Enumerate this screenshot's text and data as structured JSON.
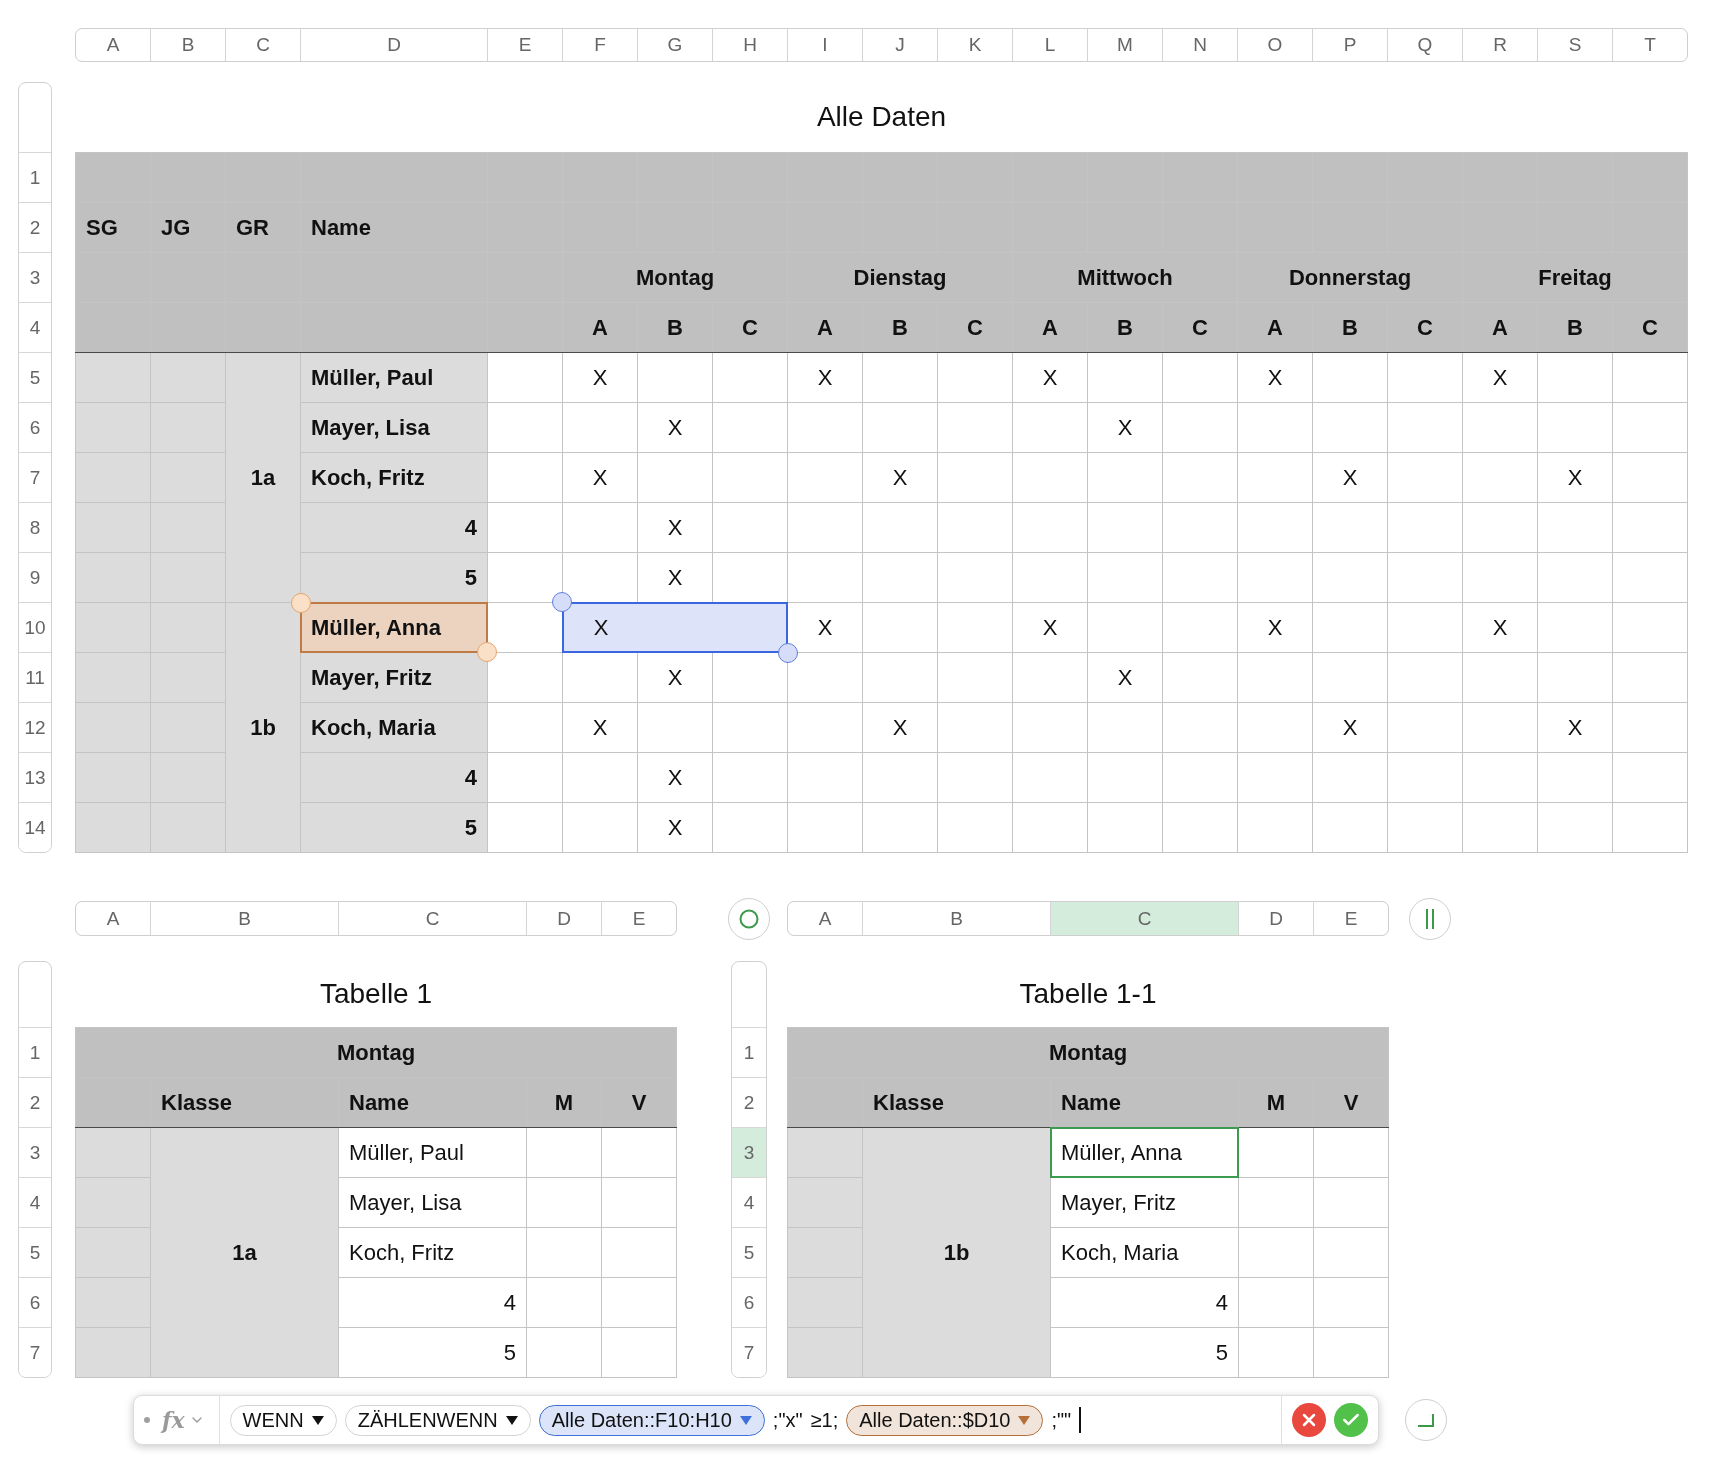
{
  "main_table": {
    "column_letters": [
      "A",
      "B",
      "C",
      "D",
      "E",
      "F",
      "G",
      "H",
      "I",
      "J",
      "K",
      "L",
      "M",
      "N",
      "O",
      "P",
      "Q",
      "R",
      "S",
      "T"
    ],
    "title": "Alle Daten",
    "row_numbers": [
      "1",
      "2",
      "3",
      "4",
      "5",
      "6",
      "7",
      "8",
      "9",
      "10",
      "11",
      "12",
      "13",
      "14"
    ],
    "header_labels": [
      "SG",
      "JG",
      "GR",
      "Name"
    ],
    "days": [
      {
        "name": "Montag",
        "slots": [
          "A",
          "B",
          "C"
        ]
      },
      {
        "name": "Dienstag",
        "slots": [
          "A",
          "B",
          "C"
        ]
      },
      {
        "name": "Mittwoch",
        "slots": [
          "A",
          "B",
          "C"
        ]
      },
      {
        "name": "Donnerstag",
        "slots": [
          "A",
          "B",
          "C"
        ]
      },
      {
        "name": "Freitag",
        "slots": [
          "A",
          "B",
          "C"
        ]
      }
    ],
    "groups": [
      {
        "label": "1a",
        "rows": [
          {
            "name": "Müller, Paul",
            "kind": "text",
            "name_referenced": false,
            "range_selected": false,
            "cells": [
              "X",
              null,
              null,
              "X",
              null,
              null,
              "X",
              null,
              null,
              "X",
              null,
              null,
              "X",
              null,
              null
            ]
          },
          {
            "name": "Mayer, Lisa",
            "kind": "text",
            "name_referenced": false,
            "range_selected": false,
            "cells": [
              null,
              "X",
              null,
              null,
              null,
              null,
              null,
              "X",
              null,
              null,
              null,
              null,
              null,
              null,
              null
            ]
          },
          {
            "name": "Koch, Fritz",
            "kind": "text",
            "name_referenced": false,
            "range_selected": false,
            "cells": [
              "X",
              null,
              null,
              null,
              "X",
              null,
              null,
              null,
              null,
              null,
              "X",
              null,
              null,
              "X",
              null
            ]
          },
          {
            "name": "4",
            "kind": "number",
            "name_referenced": false,
            "range_selected": false,
            "cells": [
              null,
              "X",
              null,
              null,
              null,
              null,
              null,
              null,
              null,
              null,
              null,
              null,
              null,
              null,
              null
            ]
          },
          {
            "name": "5",
            "kind": "number",
            "name_referenced": false,
            "range_selected": false,
            "cells": [
              null,
              "X",
              null,
              null,
              null,
              null,
              null,
              null,
              null,
              null,
              null,
              null,
              null,
              null,
              null
            ]
          }
        ]
      },
      {
        "label": "1b",
        "rows": [
          {
            "name": "Müller, Anna",
            "kind": "text",
            "name_referenced": true,
            "range_selected": true,
            "cells": [
              "X",
              null,
              null,
              "X",
              null,
              null,
              "X",
              null,
              null,
              "X",
              null,
              null,
              "X",
              null,
              null
            ]
          },
          {
            "name": "Mayer, Fritz",
            "kind": "text",
            "name_referenced": false,
            "range_selected": false,
            "cells": [
              null,
              "X",
              null,
              null,
              null,
              null,
              null,
              "X",
              null,
              null,
              null,
              null,
              null,
              null,
              null
            ]
          },
          {
            "name": "Koch, Maria",
            "kind": "text",
            "name_referenced": false,
            "range_selected": false,
            "cells": [
              "X",
              null,
              null,
              null,
              "X",
              null,
              null,
              null,
              null,
              null,
              "X",
              null,
              null,
              "X",
              null
            ]
          },
          {
            "name": "4",
            "kind": "number",
            "name_referenced": false,
            "range_selected": false,
            "cells": [
              null,
              "X",
              null,
              null,
              null,
              null,
              null,
              null,
              null,
              null,
              null,
              null,
              null,
              null,
              null
            ]
          },
          {
            "name": "5",
            "kind": "number",
            "name_referenced": false,
            "range_selected": false,
            "cells": [
              null,
              "X",
              null,
              null,
              null,
              null,
              null,
              null,
              null,
              null,
              null,
              null,
              null,
              null,
              null
            ]
          }
        ]
      }
    ]
  },
  "small_tables": [
    {
      "column_letters": [
        {
          "label": "A",
          "selected": false
        },
        {
          "label": "B",
          "selected": false
        },
        {
          "label": "C",
          "selected": false
        },
        {
          "label": "D",
          "selected": false
        },
        {
          "label": "E",
          "selected": false
        }
      ],
      "title": "Tabelle 1",
      "row_numbers": [
        {
          "label": "1",
          "selected": false
        },
        {
          "label": "2",
          "selected": false
        },
        {
          "label": "3",
          "selected": false
        },
        {
          "label": "4",
          "selected": false
        },
        {
          "label": "5",
          "selected": false
        },
        {
          "label": "6",
          "selected": false
        },
        {
          "label": "7",
          "selected": false
        }
      ],
      "header": "Montag",
      "columns": [
        "Klasse",
        "Name",
        "M",
        "V"
      ],
      "group": "1a",
      "rows": [
        {
          "name": "Müller, Paul",
          "kind": "text",
          "selected": false
        },
        {
          "name": "Mayer, Lisa",
          "kind": "text",
          "selected": false
        },
        {
          "name": "Koch, Fritz",
          "kind": "text",
          "selected": false
        },
        {
          "name": "4",
          "kind": "number",
          "selected": false
        },
        {
          "name": "5",
          "kind": "number",
          "selected": false
        }
      ]
    },
    {
      "column_letters": [
        {
          "label": "A",
          "selected": false
        },
        {
          "label": "B",
          "selected": false
        },
        {
          "label": "C",
          "selected": true
        },
        {
          "label": "D",
          "selected": false
        },
        {
          "label": "E",
          "selected": false
        }
      ],
      "title": "Tabelle 1-1",
      "row_numbers": [
        {
          "label": "1",
          "selected": false
        },
        {
          "label": "2",
          "selected": false
        },
        {
          "label": "3",
          "selected": true
        },
        {
          "label": "4",
          "selected": false
        },
        {
          "label": "5",
          "selected": false
        },
        {
          "label": "6",
          "selected": false
        },
        {
          "label": "7",
          "selected": false
        }
      ],
      "header": "Montag",
      "columns": [
        "Klasse",
        "Name",
        "M",
        "V"
      ],
      "group": "1b",
      "rows": [
        {
          "name": "Müller, Anna",
          "kind": "text",
          "selected": true
        },
        {
          "name": "Mayer, Fritz",
          "kind": "text",
          "selected": false
        },
        {
          "name": "Koch, Maria",
          "kind": "text",
          "selected": false
        },
        {
          "name": "4",
          "kind": "number",
          "selected": false
        },
        {
          "name": "5",
          "kind": "number",
          "selected": false
        }
      ]
    }
  ],
  "formula_bar": {
    "function_symbol": "fx",
    "tokens": [
      {
        "kind": "function",
        "text": "WENN"
      },
      {
        "kind": "function",
        "text": "ZÄHLENWENN"
      },
      {
        "kind": "reference",
        "text": "Alle Daten::F10:H10",
        "color": "#3f6fd8"
      },
      {
        "kind": "text",
        "text": ";\"x\""
      },
      {
        "kind": "text",
        "text": "≥1;"
      },
      {
        "kind": "reference",
        "text": "Alle Daten::$D10",
        "color": "#b5703a"
      },
      {
        "kind": "text",
        "text": ";\"\""
      }
    ]
  }
}
